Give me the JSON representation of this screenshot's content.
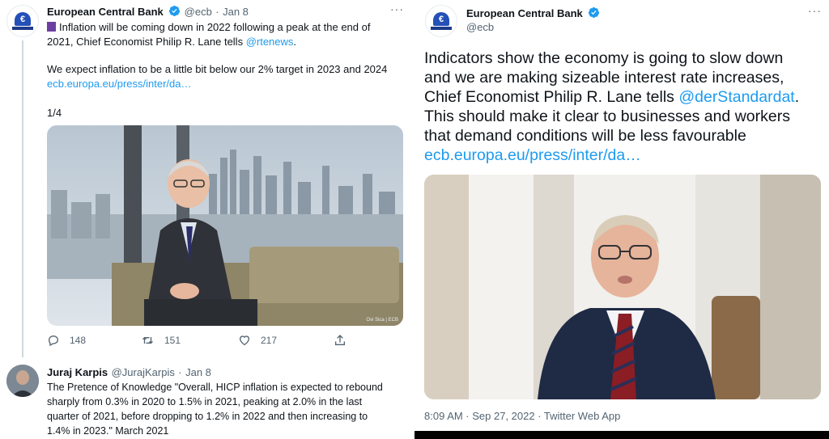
{
  "left_tweet": {
    "author_name": "European Central Bank",
    "author_handle": "@ecb",
    "dot": "·",
    "date": "Jan 8",
    "more": "···",
    "line1_emoji": "▐",
    "line1": "Inflation will be coming down in 2022 following a peak at the end of",
    "line2_prefix": "2021, Chief Economist Philip R. Lane tells ",
    "line2_mention": "@rtenews",
    "line2_suffix": ".",
    "line3": "We expect inflation to be a little bit below our 2% target in 2023 and 2024",
    "link": "ecb.europa.eu/press/inter/da…",
    "thread_count": "1/4",
    "photo_credit": "Ovi Sica | ECB",
    "replies": "148",
    "retweets": "151",
    "likes": "217"
  },
  "reply_tweet": {
    "author_name": "Juraj Karpis",
    "author_handle": "@JurajKarpis",
    "dot": "·",
    "date": "Jan 8",
    "line1": "The Pretence of Knowledge \"Overall, HICP inflation is expected to rebound",
    "line2": "sharply from 0.3% in 2020 to 1.5% in 2021, peaking at 2.0% in the last",
    "line3": "quarter of 2021, before dropping to 1.2% in 2022 and then increasing to",
    "line4": "1.4% in 2023.\" March 2021"
  },
  "right_tweet": {
    "author_name": "European Central Bank",
    "author_handle": "@ecb",
    "more": "···",
    "text_line1": "Indicators show the economy is going to slow down",
    "text_line2": "and we are making sizeable interest rate increases,",
    "text_line3_prefix": "Chief Economist Philip R. Lane tells ",
    "text_line3_mention": "@derStandardat",
    "text_line3_suffix": ".",
    "text_line4": "This should make it clear to businesses and workers",
    "text_line5": "that demand conditions will be less favourable",
    "link": "ecb.europa.eu/press/inter/da…",
    "footer": "8:09 AM · Sep 27, 2022 · Twitter Web App"
  },
  "colors": {
    "link": "#1d9bf0",
    "verified": "#1d9bf0",
    "secondary_text": "#536471",
    "ecb_blue": "#2450b8"
  },
  "logo_symbol": "€",
  "icons": [
    "verified-badge-icon",
    "more-icon",
    "reply-icon",
    "retweet-icon",
    "like-icon",
    "share-icon",
    "ecb-logo"
  ]
}
